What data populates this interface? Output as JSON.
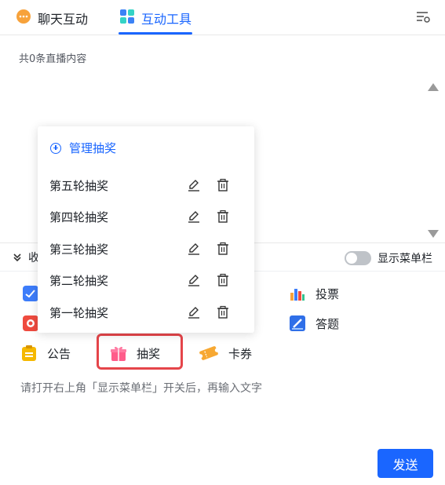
{
  "tabs": {
    "chat_label": "聊天互动",
    "tools_label": "互动工具"
  },
  "content": {
    "count_text": "共0条直播内容"
  },
  "toolbar": {
    "collapse_label": "收",
    "menu_toggle_label": "显示菜单栏",
    "menu_toggle_on": false
  },
  "tools": {
    "vote_label": "投票",
    "quiz_label": "答题",
    "notice_label": "公告",
    "lottery_label": "抽奖",
    "coupon_label": "卡券"
  },
  "hint_text": "请打开右上角「显示菜单栏」开关后，再输入文字",
  "send_label": "发送",
  "lottery_popup": {
    "manage_label": "管理抽奖",
    "items": [
      {
        "name": "第五轮抽奖"
      },
      {
        "name": "第四轮抽奖"
      },
      {
        "name": "第三轮抽奖"
      },
      {
        "name": "第二轮抽奖"
      },
      {
        "name": "第一轮抽奖"
      }
    ]
  },
  "colors": {
    "accent": "#1a66ff",
    "highlight_border": "#e5454a",
    "text": "#1f2329",
    "muted_text": "#6b6f76"
  },
  "icons": {
    "chat_tab": "chat-bubble-icon",
    "tools_tab": "grid-apps-icon",
    "settings": "list-settings-icon",
    "collapse": "double-chevron-down-icon",
    "vote": "bar-chart-icon",
    "quiz": "pencil-square-icon",
    "notice": "clipboard-icon",
    "lottery": "gift-box-icon",
    "coupon": "ticket-icon",
    "edit": "edit-pen-icon",
    "delete": "trash-icon"
  }
}
